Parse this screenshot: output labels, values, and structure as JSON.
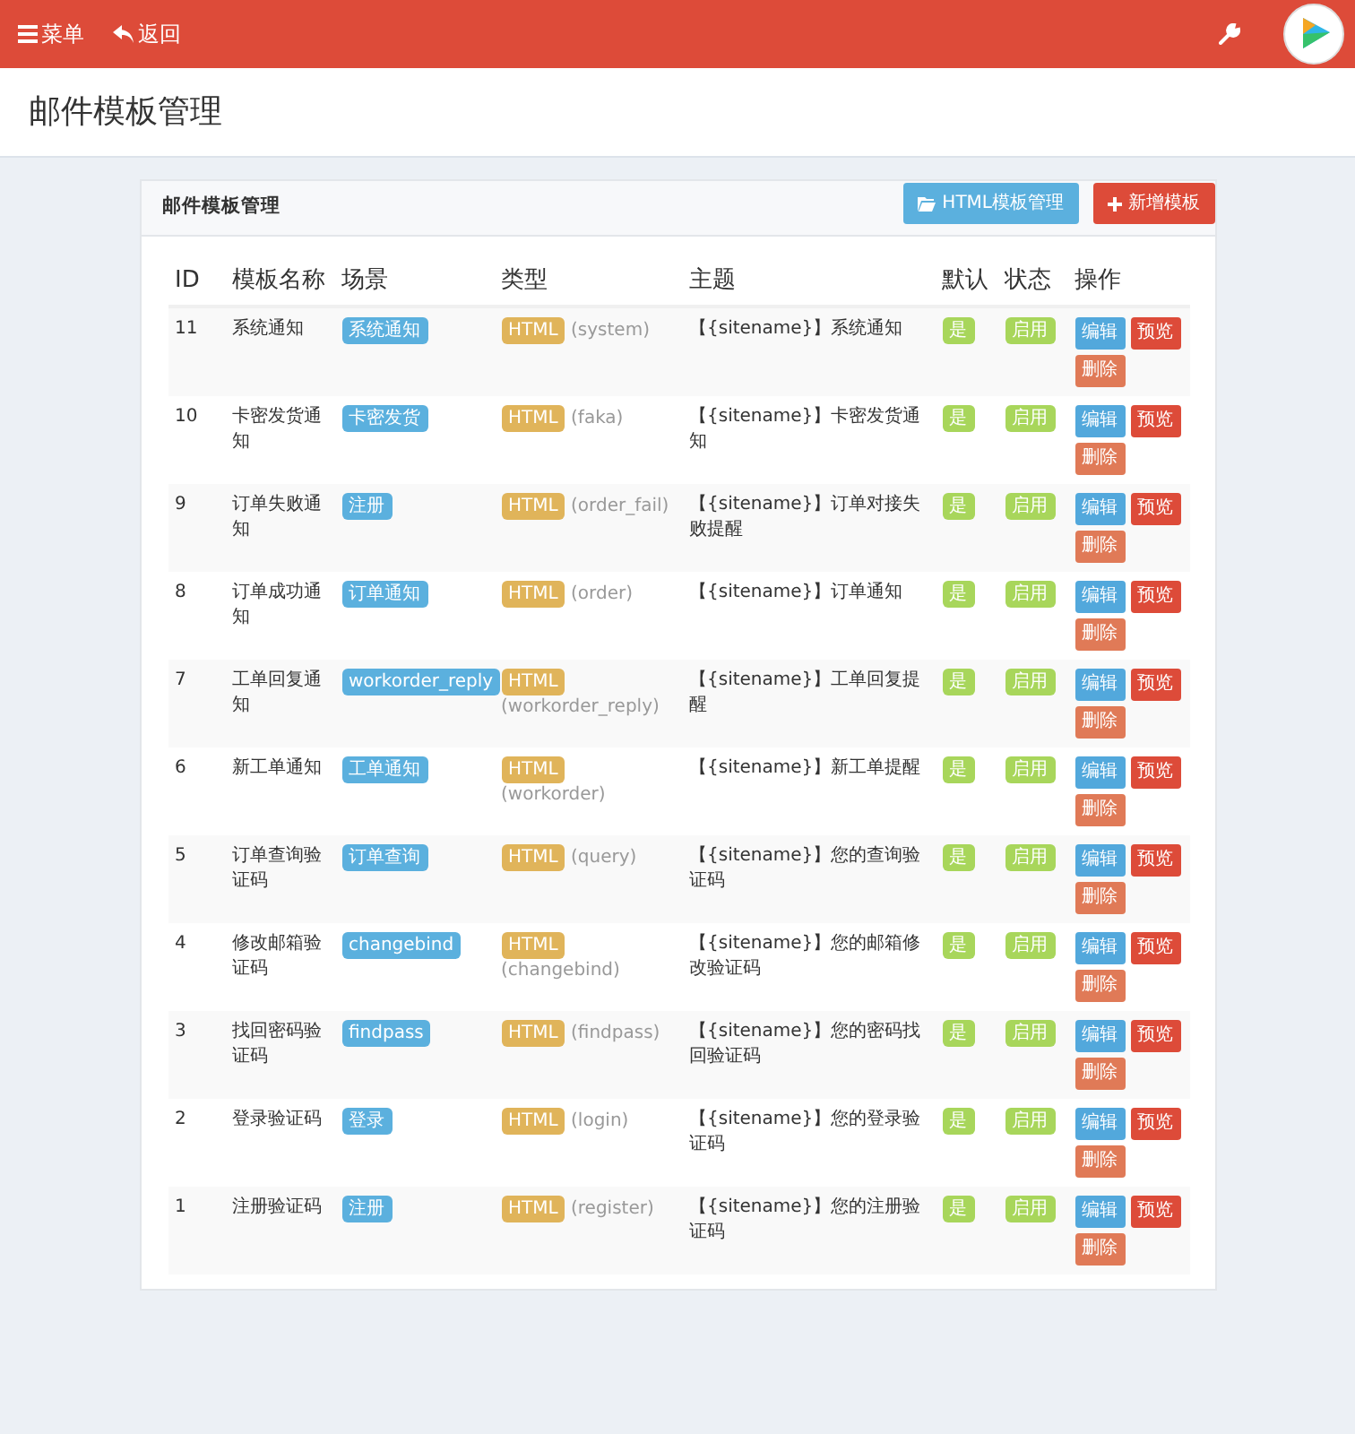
{
  "navbar": {
    "menu": "菜单",
    "back": "返回"
  },
  "page_title": "邮件模板管理",
  "card": {
    "title": "邮件模板管理",
    "buttons": [
      {
        "label": "HTML模板管理",
        "kind": "manage"
      },
      {
        "label": "新增模板",
        "kind": "add"
      }
    ]
  },
  "table": {
    "columns": [
      "ID",
      "模板名称",
      "场景",
      "类型",
      "主题",
      "默认",
      "状态",
      "操作"
    ],
    "rows": [
      {
        "id": "11",
        "name": "系统通知",
        "scene": "系统通知",
        "type": "HTML",
        "type_code": "(system)",
        "subject": "【{sitename}】系统通知",
        "default": "是",
        "status": "启用",
        "actions": [
          {
            "label": "编辑",
            "kind": "edit"
          },
          {
            "label": "预览",
            "kind": "preview"
          },
          {
            "label": "删除",
            "kind": "delete"
          }
        ]
      },
      {
        "id": "10",
        "name": "卡密发货通知",
        "scene": "卡密发货",
        "type": "HTML",
        "type_code": "(faka)",
        "subject": "【{sitename}】卡密发货通知",
        "default": "是",
        "status": "启用",
        "actions": [
          {
            "label": "编辑",
            "kind": "edit"
          },
          {
            "label": "预览",
            "kind": "preview"
          },
          {
            "label": "删除",
            "kind": "delete"
          }
        ]
      },
      {
        "id": "9",
        "name": "订单失败通知",
        "scene": "注册",
        "type": "HTML",
        "type_code": "(order_fail)",
        "subject": "【{sitename}】订单对接失败提醒",
        "default": "是",
        "status": "启用",
        "actions": [
          {
            "label": "编辑",
            "kind": "edit"
          },
          {
            "label": "预览",
            "kind": "preview"
          },
          {
            "label": "删除",
            "kind": "delete"
          }
        ]
      },
      {
        "id": "8",
        "name": "订单成功通知",
        "scene": "订单通知",
        "type": "HTML",
        "type_code": "(order)",
        "subject": "【{sitename}】订单通知",
        "default": "是",
        "status": "启用",
        "actions": [
          {
            "label": "编辑",
            "kind": "edit"
          },
          {
            "label": "预览",
            "kind": "preview"
          },
          {
            "label": "删除",
            "kind": "delete"
          }
        ]
      },
      {
        "id": "7",
        "name": "工单回复通知",
        "scene": "workorder_reply",
        "type": "HTML",
        "type_code": "(workorder_reply)",
        "subject": "【{sitename}】工单回复提醒",
        "default": "是",
        "status": "启用",
        "actions": [
          {
            "label": "编辑",
            "kind": "edit"
          },
          {
            "label": "预览",
            "kind": "preview"
          },
          {
            "label": "删除",
            "kind": "delete"
          }
        ]
      },
      {
        "id": "6",
        "name": "新工单通知",
        "scene": "工单通知",
        "type": "HTML",
        "type_code": "(workorder)",
        "subject": "【{sitename}】新工单提醒",
        "default": "是",
        "status": "启用",
        "actions": [
          {
            "label": "编辑",
            "kind": "edit"
          },
          {
            "label": "预览",
            "kind": "preview"
          },
          {
            "label": "删除",
            "kind": "delete"
          }
        ]
      },
      {
        "id": "5",
        "name": "订单查询验证码",
        "scene": "订单查询",
        "type": "HTML",
        "type_code": "(query)",
        "subject": "【{sitename}】您的查询验证码",
        "default": "是",
        "status": "启用",
        "actions": [
          {
            "label": "编辑",
            "kind": "edit"
          },
          {
            "label": "预览",
            "kind": "preview"
          },
          {
            "label": "删除",
            "kind": "delete"
          }
        ]
      },
      {
        "id": "4",
        "name": "修改邮箱验证码",
        "scene": "changebind",
        "type": "HTML",
        "type_code": "(changebind)",
        "subject": "【{sitename}】您的邮箱修改验证码",
        "default": "是",
        "status": "启用",
        "actions": [
          {
            "label": "编辑",
            "kind": "edit"
          },
          {
            "label": "预览",
            "kind": "preview"
          },
          {
            "label": "删除",
            "kind": "delete"
          }
        ]
      },
      {
        "id": "3",
        "name": "找回密码验证码",
        "scene": "findpass",
        "type": "HTML",
        "type_code": "(findpass)",
        "subject": "【{sitename}】您的密码找回验证码",
        "default": "是",
        "status": "启用",
        "actions": [
          {
            "label": "编辑",
            "kind": "edit"
          },
          {
            "label": "预览",
            "kind": "preview"
          },
          {
            "label": "删除",
            "kind": "delete"
          }
        ]
      },
      {
        "id": "2",
        "name": "登录验证码",
        "scene": "登录",
        "type": "HTML",
        "type_code": "(login)",
        "subject": "【{sitename}】您的登录验证码",
        "default": "是",
        "status": "启用",
        "actions": [
          {
            "label": "编辑",
            "kind": "edit"
          },
          {
            "label": "预览",
            "kind": "preview"
          },
          {
            "label": "删除",
            "kind": "delete"
          }
        ]
      },
      {
        "id": "1",
        "name": "注册验证码",
        "scene": "注册",
        "type": "HTML",
        "type_code": "(register)",
        "subject": "【{sitename}】您的注册验证码",
        "default": "是",
        "status": "启用",
        "actions": [
          {
            "label": "编辑",
            "kind": "edit"
          },
          {
            "label": "预览",
            "kind": "preview"
          },
          {
            "label": "删除",
            "kind": "delete"
          }
        ]
      }
    ]
  }
}
